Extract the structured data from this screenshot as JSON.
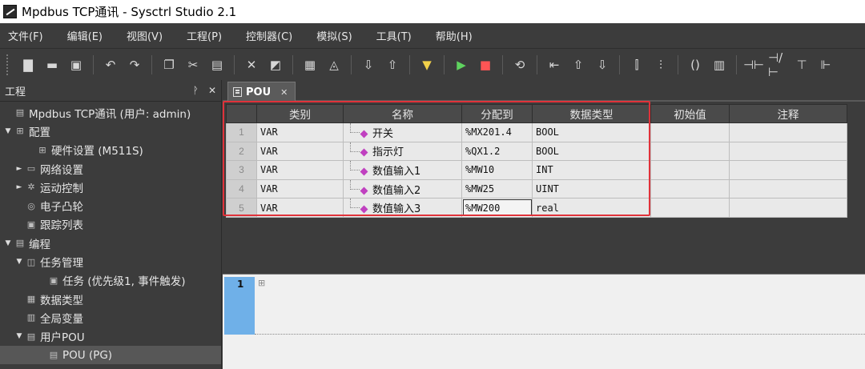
{
  "window": {
    "title": "Mpdbus TCP通讯 - Sysctrl Studio 2.1"
  },
  "menu": [
    {
      "label": "文件(F)"
    },
    {
      "label": "编辑(E)"
    },
    {
      "label": "视图(V)"
    },
    {
      "label": "工程(P)"
    },
    {
      "label": "控制器(C)"
    },
    {
      "label": "模拟(S)"
    },
    {
      "label": "工具(T)"
    },
    {
      "label": "帮助(H)"
    }
  ],
  "project_panel": {
    "title": "工程",
    "pin": "ᴘ",
    "close": "✕",
    "tree": [
      {
        "label": "Mpdbus TCP通讯 (用户: admin)",
        "indent": 0,
        "arrow": "",
        "icon": "project-icon"
      },
      {
        "label": "配置",
        "indent": 0,
        "arrow": "▼",
        "icon": "config-icon"
      },
      {
        "label": "硬件设置 (M511S)",
        "indent": 2,
        "arrow": "",
        "icon": "hardware-icon"
      },
      {
        "label": "网络设置",
        "indent": 1,
        "arrow": "►",
        "icon": "network-icon"
      },
      {
        "label": "运动控制",
        "indent": 1,
        "arrow": "►",
        "icon": "motion-icon"
      },
      {
        "label": "电子凸轮",
        "indent": 1,
        "arrow": "",
        "icon": "cam-icon"
      },
      {
        "label": "跟踪列表",
        "indent": 1,
        "arrow": "",
        "icon": "trace-icon"
      },
      {
        "label": "编程",
        "indent": 0,
        "arrow": "▼",
        "icon": "program-icon"
      },
      {
        "label": "任务管理",
        "indent": 1,
        "arrow": "▼",
        "icon": "task-manager-icon"
      },
      {
        "label": "任务 (优先级1, 事件触发)",
        "indent": 3,
        "arrow": "",
        "icon": "task-icon"
      },
      {
        "label": "数据类型",
        "indent": 1,
        "arrow": "",
        "icon": "datatype-icon"
      },
      {
        "label": "全局变量",
        "indent": 1,
        "arrow": "",
        "icon": "global-var-icon"
      },
      {
        "label": "用户POU",
        "indent": 1,
        "arrow": "▼",
        "icon": "user-pou-icon"
      },
      {
        "label": "POU (PG)",
        "indent": 3,
        "arrow": "",
        "icon": "pou-icon",
        "selected": true
      }
    ]
  },
  "doc_tab": {
    "label": "POU",
    "close": "✕"
  },
  "var_table": {
    "columns": [
      "类别",
      "名称",
      "分配到",
      "数据类型",
      "初始值",
      "注释"
    ],
    "rows": [
      {
        "num": "1",
        "category": "VAR",
        "name": "开关",
        "address": "%MX201.4",
        "type": "BOOL",
        "init": "",
        "comment": ""
      },
      {
        "num": "2",
        "category": "VAR",
        "name": "指示灯",
        "address": "%QX1.2",
        "type": "BOOL",
        "init": "",
        "comment": ""
      },
      {
        "num": "3",
        "category": "VAR",
        "name": "数值输入1",
        "address": "%MW10",
        "type": "INT",
        "init": "",
        "comment": ""
      },
      {
        "num": "4",
        "category": "VAR",
        "name": "数值输入2",
        "address": "%MW25",
        "type": "UINT",
        "init": "",
        "comment": ""
      },
      {
        "num": "5",
        "category": "VAR",
        "name": "数值输入3",
        "address": "%MW200",
        "type": "real",
        "init": "",
        "comment": ""
      }
    ]
  },
  "editor": {
    "line_number": "1",
    "fold": "⊞"
  },
  "colors": {
    "highlight": "#e0323a",
    "gutter": "#6fb0e8",
    "selected_tree": "#575757"
  }
}
